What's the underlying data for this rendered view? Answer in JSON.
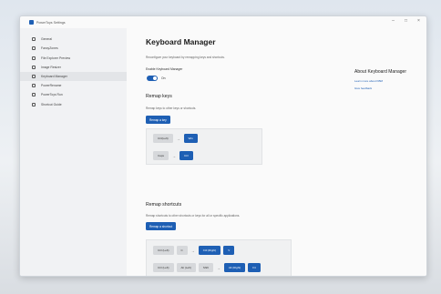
{
  "window": {
    "title": "PowerToys Settings",
    "controls": {
      "minimize": "–",
      "maximize": "□",
      "close": "×"
    }
  },
  "sidebar": {
    "items": [
      {
        "label": "General",
        "icon": "settings-icon"
      },
      {
        "label": "FancyZones",
        "icon": "grid-icon"
      },
      {
        "label": "File Explorer Preview",
        "icon": "folder-icon"
      },
      {
        "label": "Image Resizer",
        "icon": "image-icon"
      },
      {
        "label": "Keyboard Manager",
        "icon": "keyboard-icon"
      },
      {
        "label": "PowerRename",
        "icon": "rename-icon"
      },
      {
        "label": "PowerToys Run",
        "icon": "run-icon"
      },
      {
        "label": "Shortcut Guide",
        "icon": "shortcut-icon"
      }
    ],
    "active_index": 4
  },
  "main": {
    "title": "Keyboard Manager",
    "description": "Reconfigure your keyboard by remapping keys and shortcuts.",
    "enable_label": "Enable Keyboard Manager",
    "toggle_state": "On",
    "remap_keys": {
      "heading": "Remap keys",
      "description": "Remap keys to other keys or shortcuts.",
      "button": "Remap a key",
      "rows": [
        {
          "from": "Ctrl(Left)",
          "arrow": "→",
          "to": "Win"
        },
        {
          "from": "Caps",
          "arrow": "→",
          "to": "Ctrl"
        }
      ]
    },
    "remap_shortcuts": {
      "heading": "Remap shortcuts",
      "description": "Remap shortcuts to other shortcuts or keys for all or specific applications.",
      "button": "Remap a shortcut",
      "rows": [
        {
          "from": [
            "Ctrl (Left)",
            "C"
          ],
          "arrow": "→",
          "to": [
            "Ctrl (Right)",
            "V"
          ]
        },
        {
          "from": [
            "Ctrl (Left)",
            "Alt (Left)",
            "Shift"
          ],
          "arrow": "→",
          "to": [
            "Alt (Right)",
            "F4"
          ]
        }
      ]
    }
  },
  "about": {
    "title": "About Keyboard Manager",
    "links": [
      "Learn more about KBM",
      "Give feedback"
    ]
  }
}
